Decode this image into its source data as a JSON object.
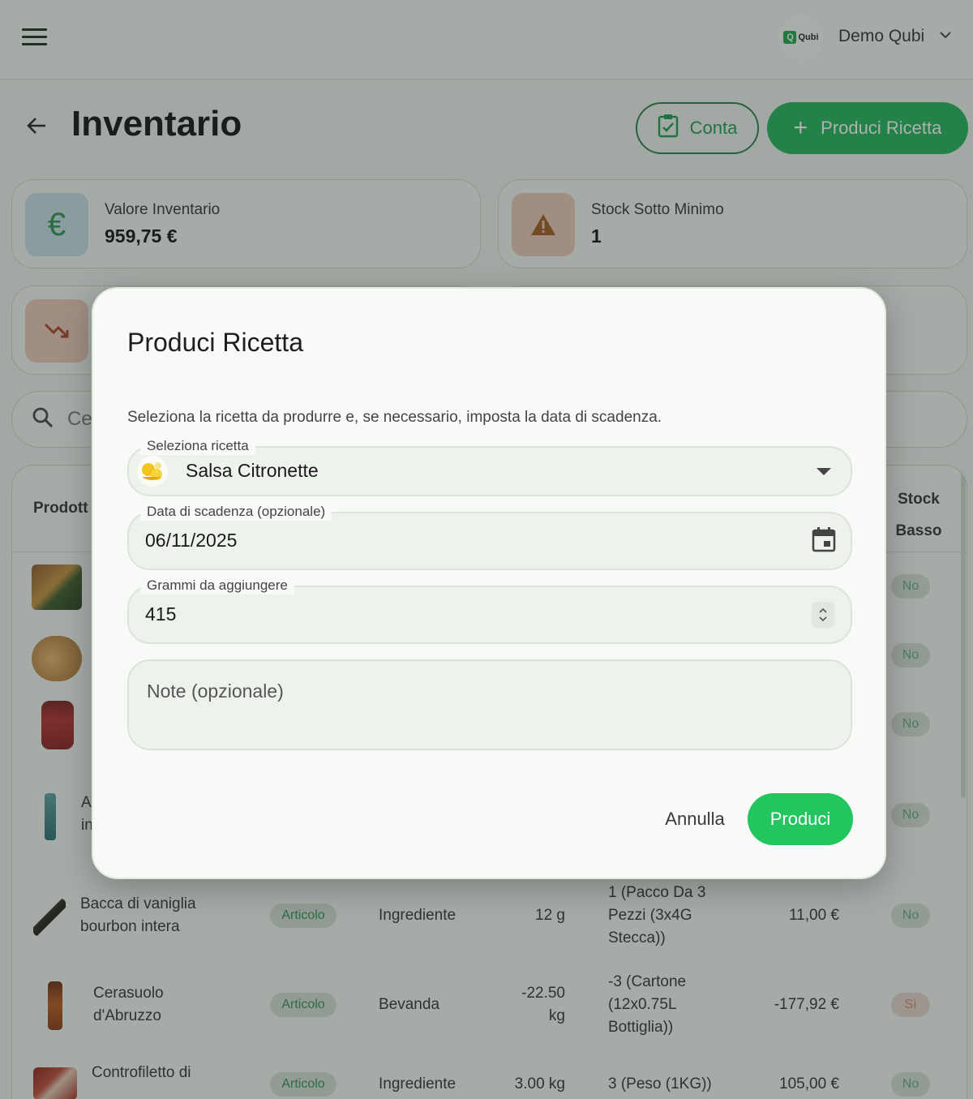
{
  "header": {
    "logo_text": "Qubi",
    "user_name": "Demo Qubi"
  },
  "page": {
    "title": "Inventario",
    "conta_label": "Conta",
    "produci_ricetta_label": "Produci Ricetta"
  },
  "stats": [
    {
      "label": "Valore Inventario",
      "value": "959,75 €",
      "icon": "euro-icon",
      "color": "#c9dde8"
    },
    {
      "label": "Stock Sotto Minimo",
      "value": "1",
      "icon": "warning-icon",
      "color": "#ecc7b9"
    }
  ],
  "search": {
    "placeholder_visible": "Ce"
  },
  "table": {
    "headers": {
      "product": "Prodott",
      "stock_basso": "Stock Basso"
    },
    "stock_flags": [
      "No",
      "No",
      "No",
      "No"
    ],
    "partial_name": {
      "line1": "A",
      "line2": "in"
    },
    "rows": [
      {
        "name": "Bacca di vaniglia bourbon intera",
        "type": "Articolo",
        "category": "Ingrediente",
        "qty": "12 g",
        "units": "1 (Pacco Da 3 Pezzi (3x4G Stecca))",
        "value": "11,00 €",
        "low": "No"
      },
      {
        "name": "Cerasuolo d'Abruzzo",
        "type": "Articolo",
        "category": "Bevanda",
        "qty": "-22.50 kg",
        "units": "-3 (Cartone (12x0.75L Bottiglia))",
        "value": "-177,92 €",
        "low": "Sì"
      },
      {
        "name": "Controfiletto di manzo",
        "type": "Articolo",
        "category": "Ingrediente",
        "qty": "3.00 kg",
        "units": "3 (Peso (1KG))",
        "value": "105,00 €",
        "low": "No"
      }
    ]
  },
  "dialog": {
    "title": "Produci Ricetta",
    "description": "Seleziona la ricetta da produrre e, se necessario, imposta la data di scadenza.",
    "recipe_label": "Seleziona ricetta",
    "recipe_value": "Salsa Citronette",
    "expiry_label": "Data di scadenza (opzionale)",
    "expiry_value": "06/11/2025",
    "grams_label": "Grammi da aggiungere",
    "grams_value": "415",
    "notes_placeholder": "Note (opzionale)",
    "cancel_label": "Annulla",
    "submit_label": "Produci"
  },
  "colors": {
    "primary": "#22b35a",
    "primary_bright": "#22c55e",
    "chip_text": "#2e9152",
    "warning_chip": "#d98570"
  }
}
